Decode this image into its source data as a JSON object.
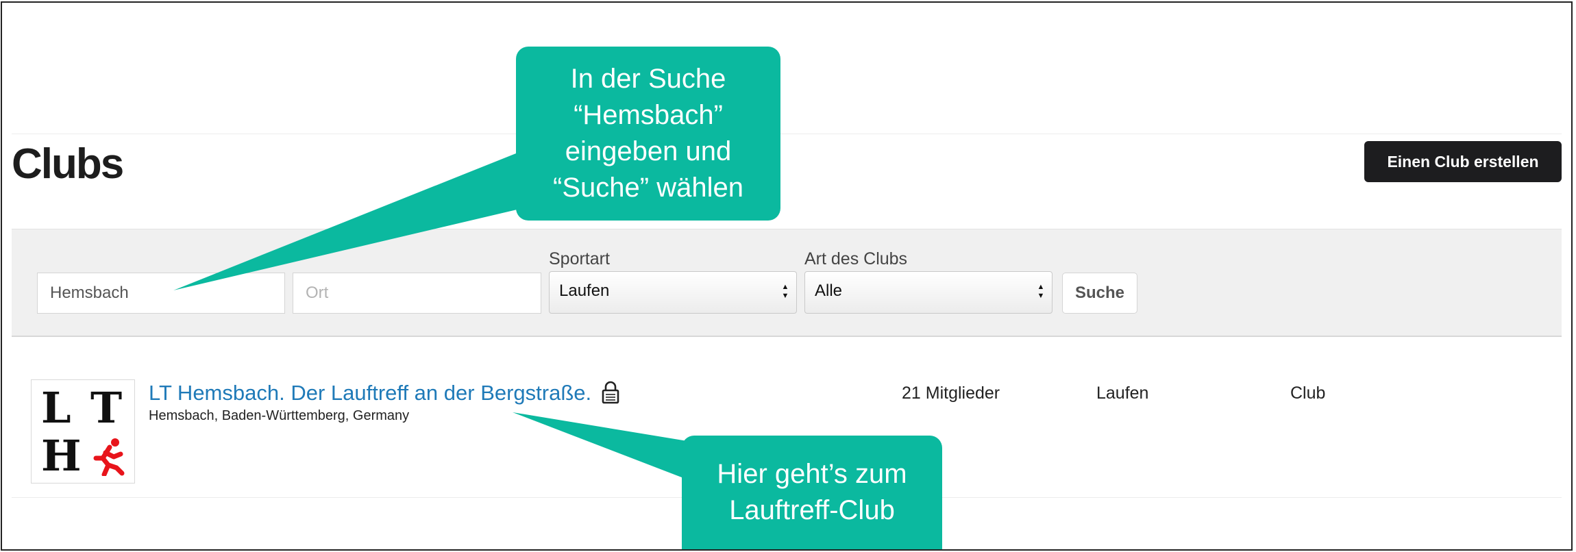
{
  "header": {
    "title": "Clubs",
    "create_button": "Einen Club erstellen"
  },
  "filters": {
    "name_value": "Hemsbach",
    "location_placeholder": "Ort",
    "sport_label": "Sportart",
    "sport_selected": "Laufen",
    "club_type_label": "Art des Clubs",
    "club_type_selected": "Alle",
    "search_button": "Suche"
  },
  "results": [
    {
      "name": "LT Hemsbach. Der Lauftreff an der Bergstraße.",
      "location": "Hemsbach, Baden-Württemberg, Germany",
      "members": "21 Mitglieder",
      "sport": "Laufen",
      "type": "Club",
      "logo_letters": [
        "L",
        "T",
        "H"
      ],
      "private": true
    }
  ],
  "annotations": {
    "search_callout_lines": [
      "In der Suche",
      "“Hemsbach”",
      "eingeben und",
      "“Suche” wählen"
    ],
    "club_callout_lines": [
      "Hier geht’s zum",
      "Lauftreff-Club"
    ]
  },
  "colors": {
    "callout": "#0bb99f",
    "link": "#1f7ab8",
    "primary_button": "#1d1d1f",
    "logo_runner": "#e8141b"
  },
  "icons": {
    "private": "lock-icon",
    "select_arrows": "chevron-up-down-icon",
    "logo_runner": "runner-icon"
  }
}
